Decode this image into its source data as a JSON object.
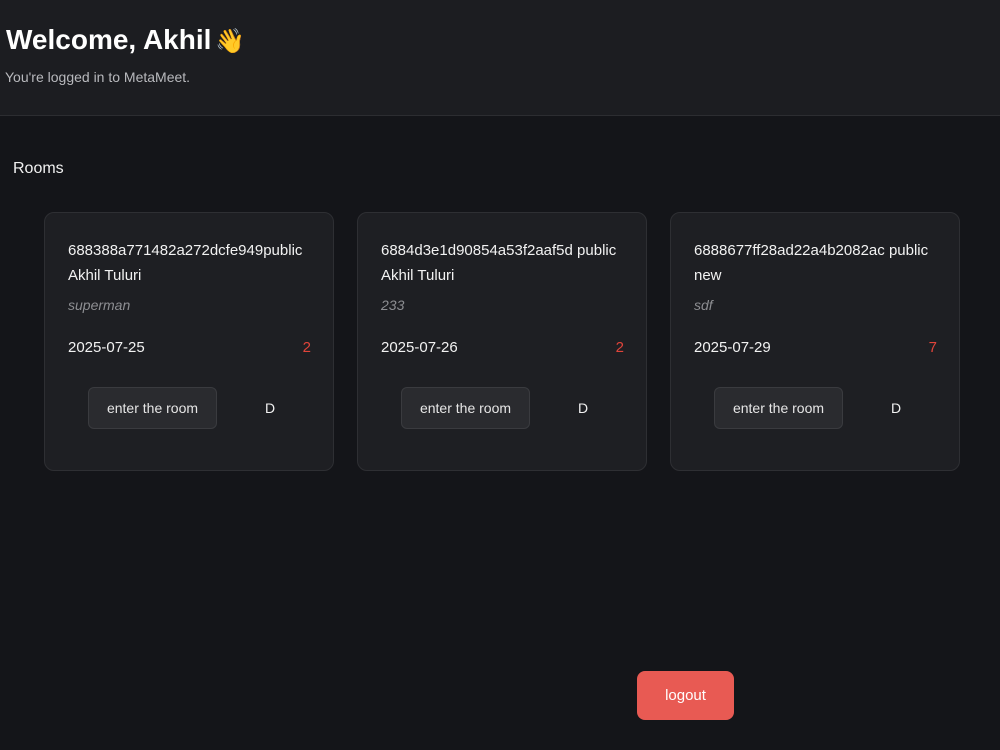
{
  "header": {
    "welcome": "Welcome, Akhil",
    "wave_emoji": "👋",
    "subtitle": "You're logged in to MetaMeet."
  },
  "rooms": {
    "label": "Rooms",
    "items": [
      {
        "id": "688388a771482a272dcfe949",
        "visibility": "public",
        "owner": "Akhil Tuluri",
        "description": "superman",
        "date": "2025-07-25",
        "count": "2",
        "enter_label": "enter the room",
        "d_label": "D"
      },
      {
        "id": "6884d3e1d90854a53f2aaf5d",
        "visibility": "public",
        "owner": "Akhil Tuluri",
        "description": "233",
        "date": "2025-07-26",
        "count": "2",
        "enter_label": "enter the room",
        "d_label": "D"
      },
      {
        "id": "6888677ff28ad22a4b2082ac",
        "visibility": "public",
        "owner": "new",
        "description": "sdf",
        "date": "2025-07-29",
        "count": "7",
        "enter_label": "enter the room",
        "d_label": "D"
      }
    ]
  },
  "logout_label": "logout",
  "colors": {
    "background": "#141519",
    "header_bg": "#1c1d21",
    "card_bg": "#1e1f23",
    "count_red": "#e0443a",
    "logout_bg": "#e85a53"
  }
}
